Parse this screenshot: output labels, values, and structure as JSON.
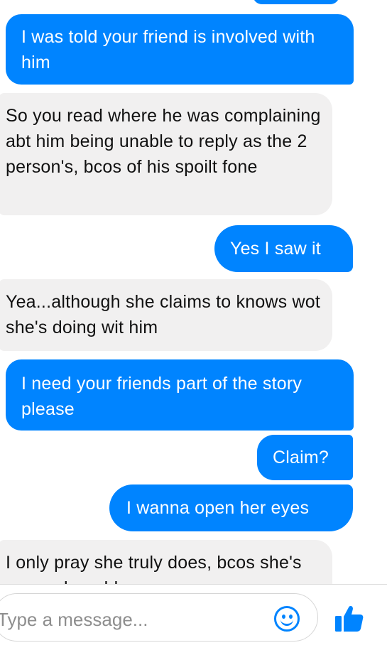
{
  "messages": [
    {
      "side": "out",
      "text": "I was told your friend is involved with him"
    },
    {
      "side": "in",
      "text": "So you read where he was complaining abt him being unable to reply as the 2 person's, bcos of his spoilt fone"
    },
    {
      "side": "out",
      "text": "Yes I saw it"
    },
    {
      "side": "in",
      "text": "Yea...although she claims to knows wot she's doing wit him"
    },
    {
      "side": "out",
      "text": "I need your friends part of the story please"
    },
    {
      "side": "out",
      "text": "Claim?"
    },
    {
      "side": "out",
      "text": "I wanna open her eyes"
    },
    {
      "side": "in",
      "text": "I only pray she truly does, bcos she's very vulnerable"
    }
  ],
  "composer": {
    "placeholder": "Type a message...",
    "emoji_icon": "smiley-face-icon",
    "send_icon": "thumbs-up-icon"
  },
  "colors": {
    "outgoing_bubble": "#0084ff",
    "incoming_bubble": "#f1f0f0",
    "accent": "#0084ff"
  }
}
